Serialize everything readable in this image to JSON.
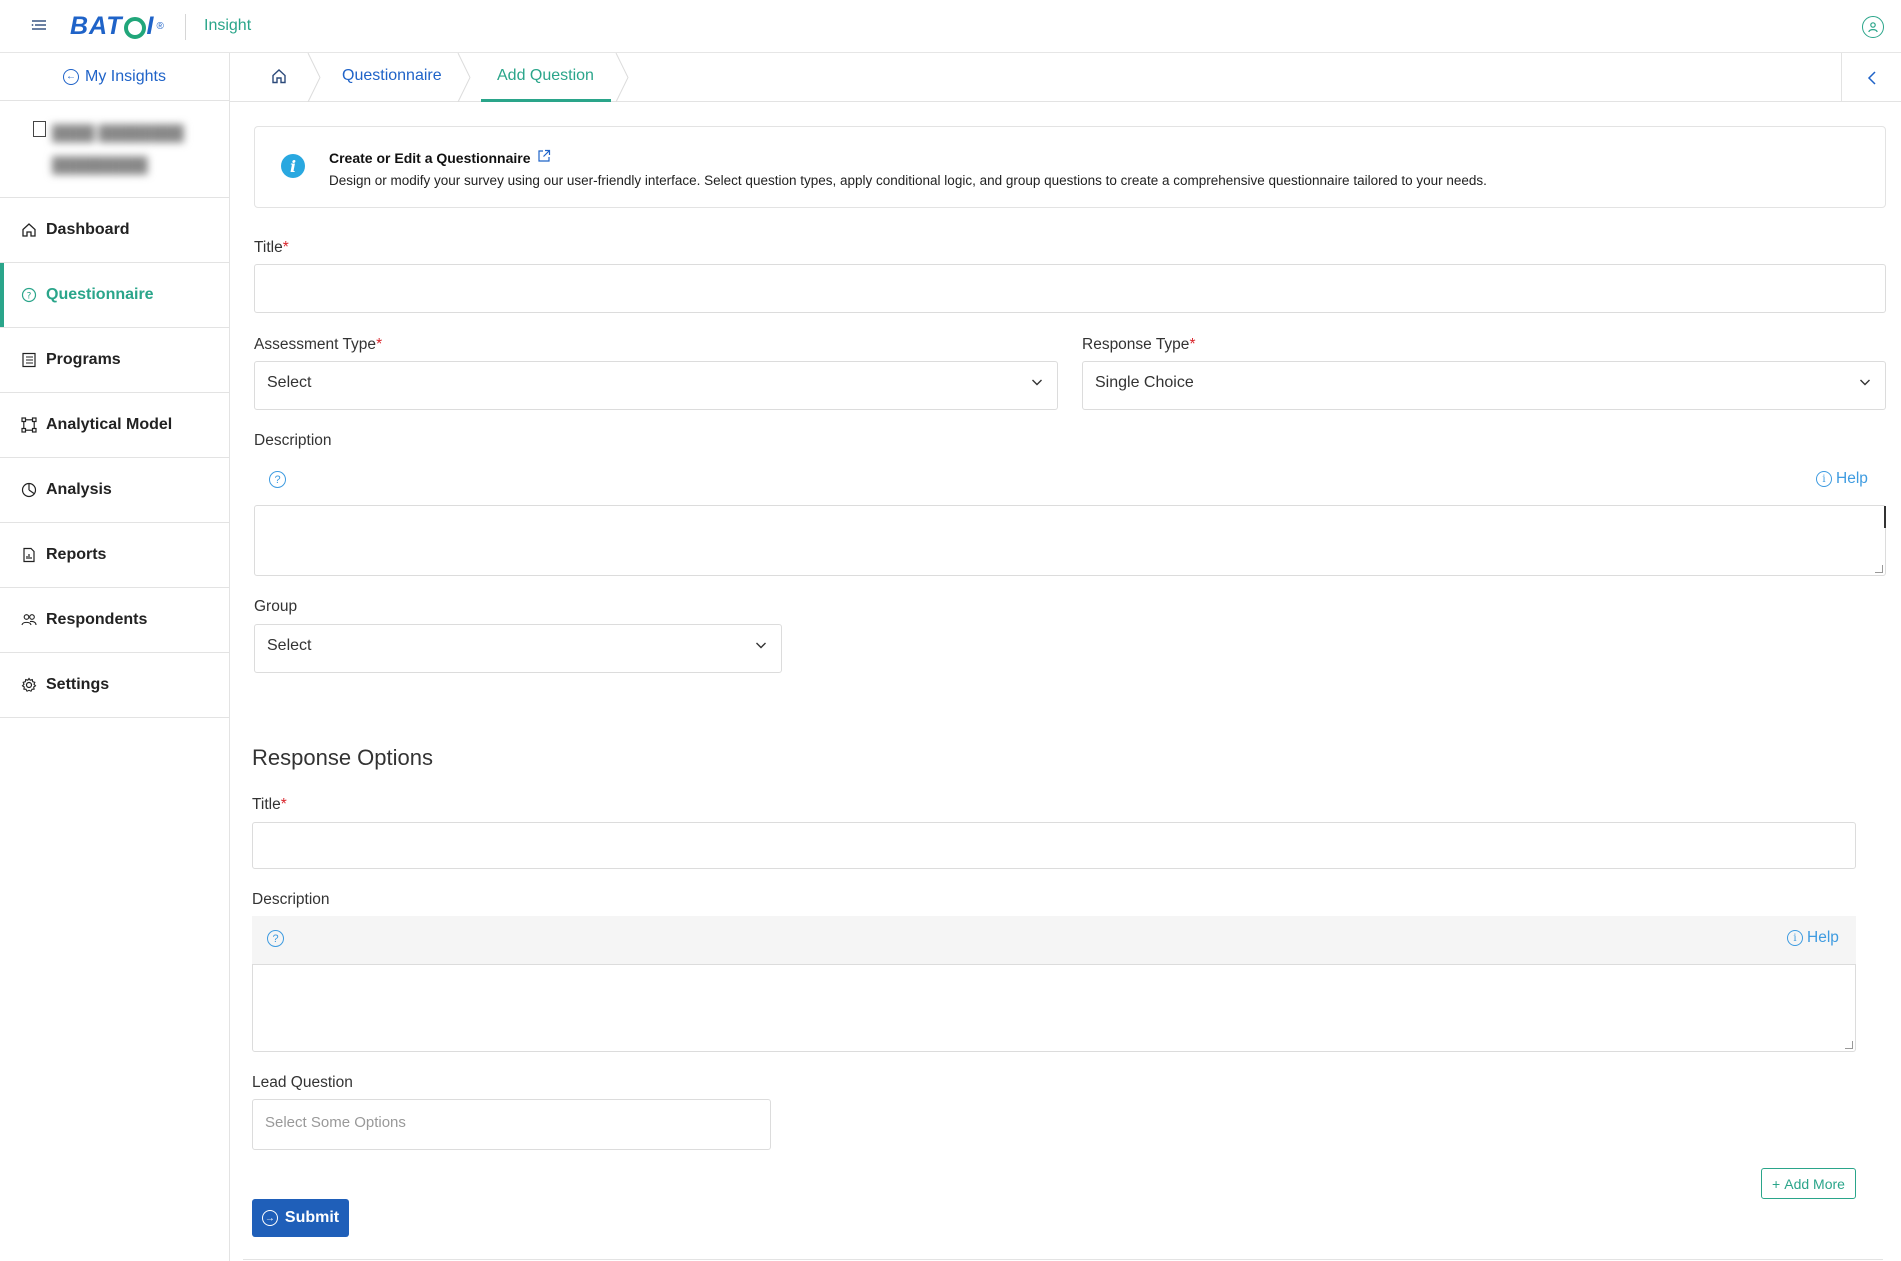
{
  "header": {
    "brand": "BATOI",
    "product": "Insight"
  },
  "sidebar": {
    "back_label": "My Insights",
    "items": [
      {
        "label": "Dashboard",
        "icon": "home-icon",
        "active": false
      },
      {
        "label": "Questionnaire",
        "icon": "question-circle-icon",
        "active": true
      },
      {
        "label": "Programs",
        "icon": "list-icon",
        "active": false
      },
      {
        "label": "Analytical Model",
        "icon": "model-icon",
        "active": false
      },
      {
        "label": "Analysis",
        "icon": "pie-icon",
        "active": false
      },
      {
        "label": "Reports",
        "icon": "report-icon",
        "active": false
      },
      {
        "label": "Respondents",
        "icon": "users-icon",
        "active": false
      },
      {
        "label": "Settings",
        "icon": "gear-icon",
        "active": false
      }
    ]
  },
  "breadcrumb": {
    "items": [
      "Questionnaire",
      "Add Question"
    ]
  },
  "info": {
    "title": "Create or Edit a Questionnaire",
    "description": "Design or modify your survey using our user-friendly interface. Select question types, apply conditional logic, and group questions to create a comprehensive questionnaire tailored to your needs."
  },
  "form": {
    "title_label": "Title",
    "title_value": "",
    "assessment_type_label": "Assessment Type",
    "assessment_type_value": "Select",
    "response_type_label": "Response Type",
    "response_type_value": "Single Choice",
    "description_label": "Description",
    "help_label": "Help",
    "group_label": "Group",
    "group_value": "Select"
  },
  "response_options": {
    "heading": "Response Options",
    "title_label": "Title",
    "description_label": "Description",
    "help_label": "Help",
    "lead_question_label": "Lead Question",
    "lead_question_placeholder": "Select Some Options",
    "add_more_label": "Add More"
  },
  "actions": {
    "submit_label": "Submit"
  },
  "colors": {
    "accent_green": "#2aa58a",
    "brand_blue": "#1f63c8",
    "submit_blue": "#1f5fb9",
    "required_red": "#d9242b",
    "info_blue": "#29a8e0"
  }
}
